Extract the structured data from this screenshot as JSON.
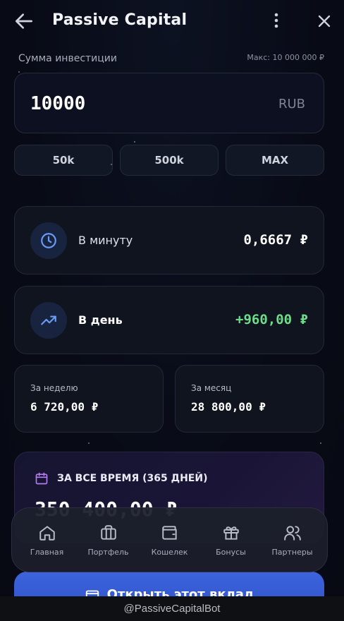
{
  "header": {
    "title": "Passive Capital",
    "back_icon": "arrow-left-icon",
    "more_icon": "more-vertical-icon",
    "close_icon": "close-icon"
  },
  "investment": {
    "label": "Сумма инвестиции",
    "max_hint": "Макс: 10 000 000 ₽",
    "amount": "10000",
    "currency": "RUB",
    "presets": [
      "50k",
      "500k",
      "MAX"
    ]
  },
  "rates": {
    "per_minute": {
      "label": "В минуту",
      "value": "0,6667 ₽",
      "icon": "clock-icon"
    },
    "per_day": {
      "label": "В день",
      "value": "+960,00 ₽",
      "icon": "trending-up-icon",
      "value_color": "#6fdc8c"
    }
  },
  "periods": {
    "week": {
      "label": "За неделю",
      "value": "6 720,00 ₽"
    },
    "month": {
      "label": "За месяц",
      "value": "28 800,00 ₽"
    }
  },
  "total": {
    "icon": "calendar-icon",
    "label": "ЗА ВСЕ ВРЕМЯ (365 ДНЕЙ)",
    "value": "350 400,00 ₽"
  },
  "cta": {
    "label": "Открыть этот вклад",
    "icon": "wallet-icon"
  },
  "tabbar": [
    {
      "label": "Главная",
      "icon": "home-icon"
    },
    {
      "label": "Портфель",
      "icon": "briefcase-icon"
    },
    {
      "label": "Кошелек",
      "icon": "wallet-icon"
    },
    {
      "label": "Бонусы",
      "icon": "gift-icon"
    },
    {
      "label": "Партнеры",
      "icon": "users-icon"
    }
  ],
  "footer": {
    "bot_name": "@PassiveCapitalBot"
  },
  "colors": {
    "accent": "#3d64dd",
    "positive": "#6fdc8c",
    "background": "#080b16",
    "calendar_accent": "#b37cf2"
  }
}
